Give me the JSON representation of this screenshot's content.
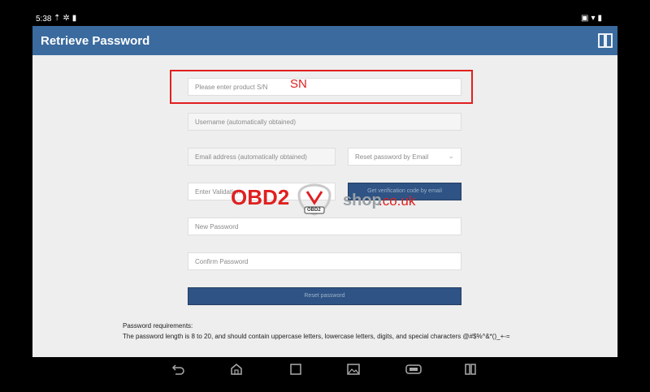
{
  "status_bar": {
    "time": "5:38",
    "left_icons": [
      "upload-icon",
      "settings-icon",
      "video-icon"
    ],
    "right_icons": [
      "cast-icon",
      "wifi-icon",
      "battery-icon"
    ]
  },
  "header": {
    "title": "Retrieve Password",
    "background_color": "#3a6a9e"
  },
  "form": {
    "serial_placeholder": "Please enter product S/N",
    "annotation": "SN",
    "username_placeholder": "Username (automatically obtained)",
    "email_placeholder": "Email address (automatically obtained)",
    "reset_method_value": "Reset password by Email",
    "validation_placeholder": "Enter Validation",
    "get_code_label": "Get verification code by email",
    "new_password_placeholder": "New Password",
    "confirm_password_placeholder": "Confirm Password",
    "reset_label": "Reset password"
  },
  "requirements": {
    "title": "Password requirements:",
    "text": "The password length is 8 to 20, and should contain uppercase letters, lowercase letters, digits, and special characters @#$%^&*()_+-="
  },
  "watermark": {
    "brand": "OBD2",
    "shop": "shop",
    "domain": ".co.uk",
    "badge": "OBD2"
  },
  "nav_bar": {
    "icons": [
      "back-icon",
      "home-icon",
      "recents-icon",
      "gallery-icon",
      "vci-icon",
      "split-screen-icon"
    ]
  },
  "colors": {
    "accent": "#3a6a9e",
    "button": "#2e5384",
    "highlight_red": "#e02020"
  }
}
